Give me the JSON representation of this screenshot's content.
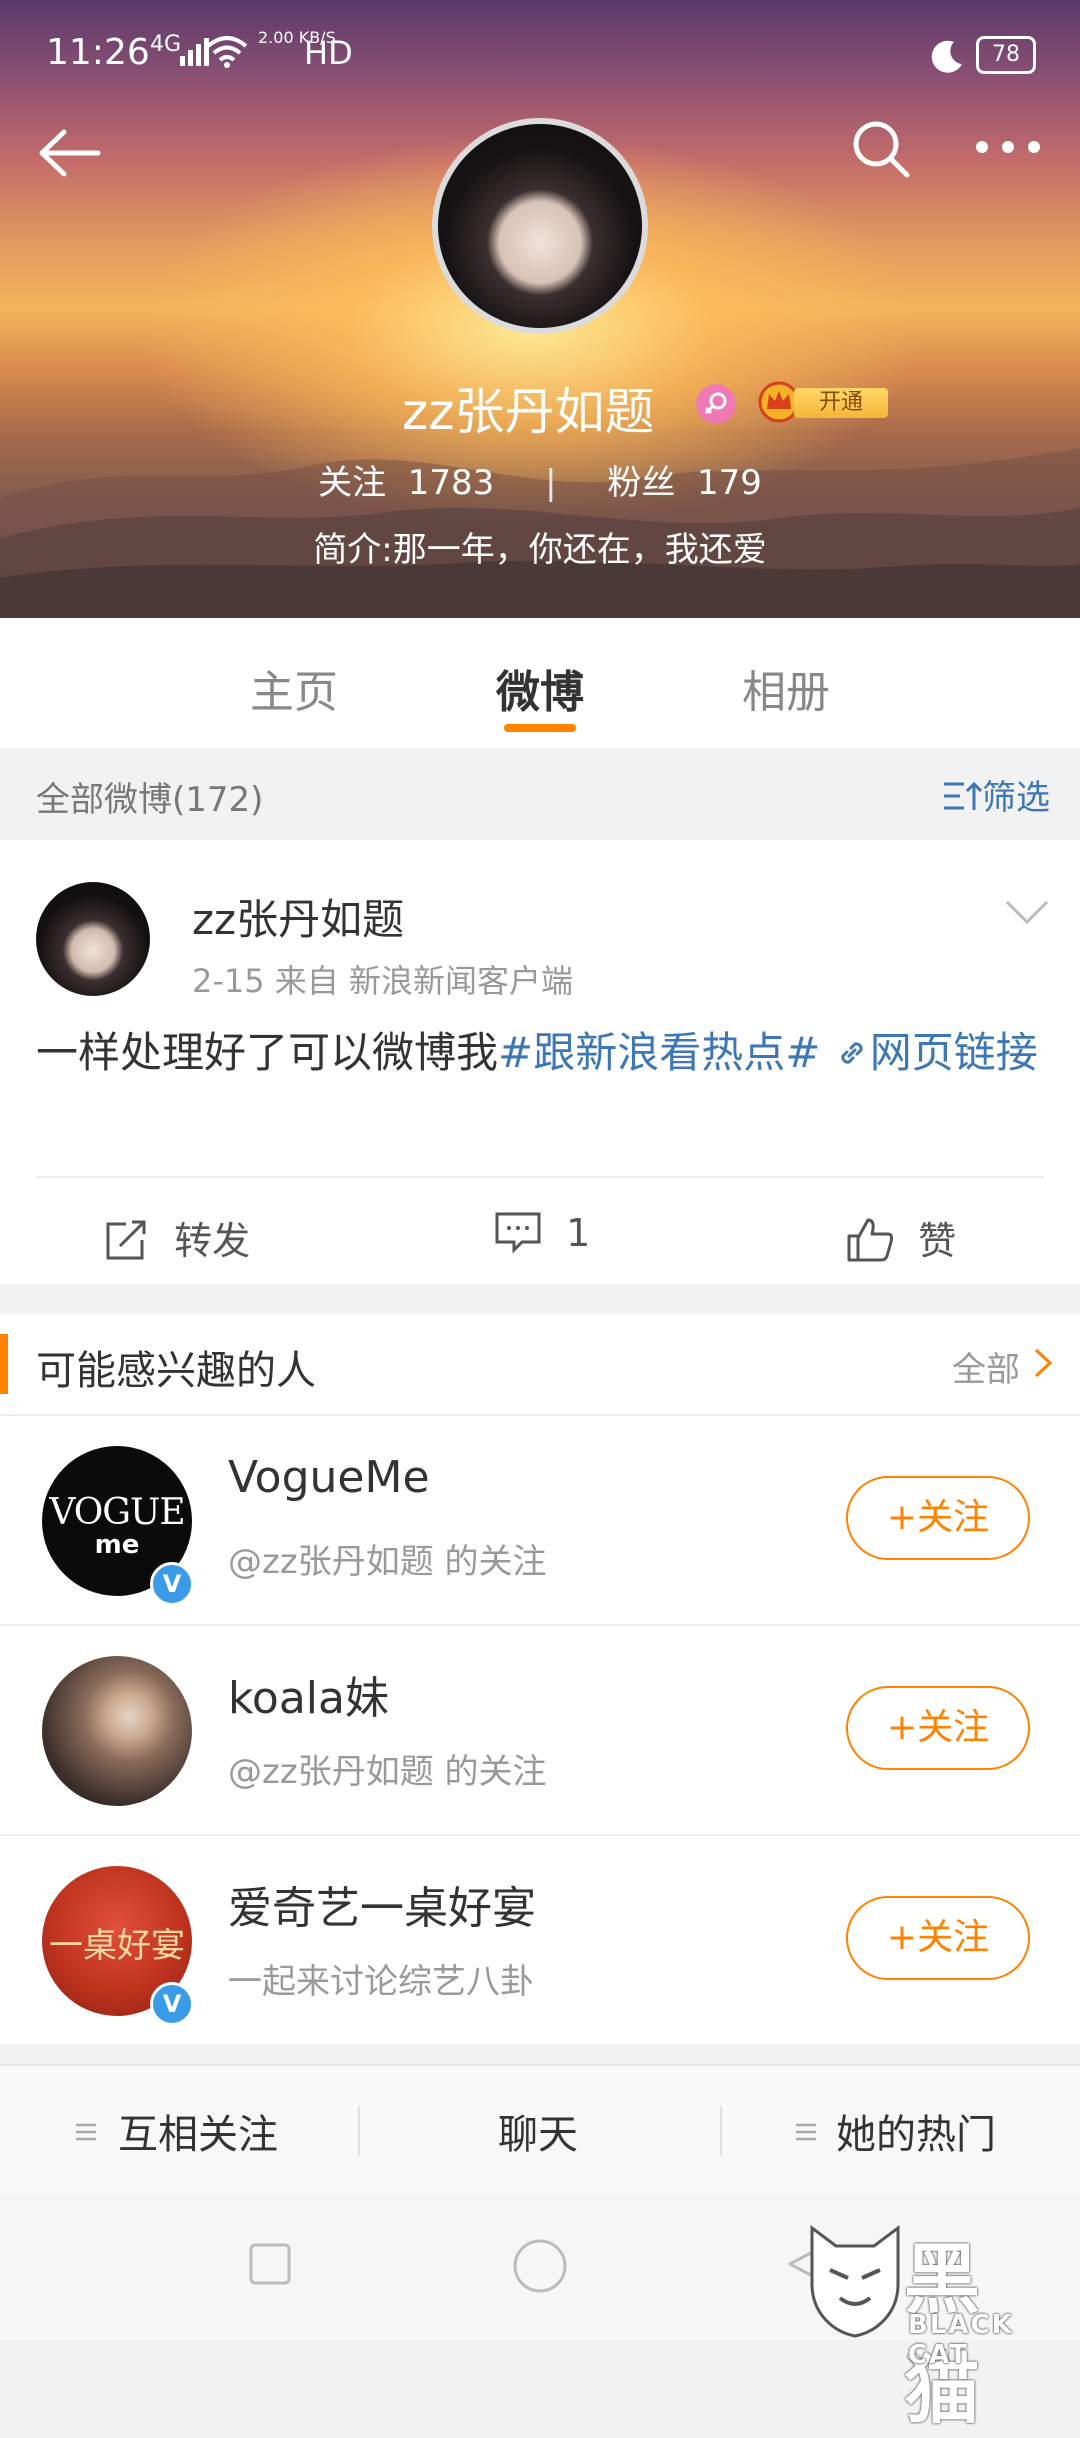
{
  "status_bar": {
    "time": "11:26",
    "network": "4G",
    "speed": "2.00 KB/S",
    "hd": "HD",
    "battery": "78"
  },
  "profile": {
    "name": "zz张丹如题",
    "vip_label": "开通",
    "following_label": "关注",
    "following_count": "1783",
    "separator": "|",
    "followers_label": "粉丝",
    "followers_count": "179",
    "intro": "简介:那一年，你还在，我还爱"
  },
  "tabs": [
    {
      "label": "主页"
    },
    {
      "label": "微博"
    },
    {
      "label": "相册"
    }
  ],
  "filter_bar": {
    "label": "全部微博(172)",
    "filter": "筛选"
  },
  "post": {
    "author": "zz张丹如题",
    "meta": "2-15  来自 新浪新闻客户端",
    "text_plain": "一样处理好了可以微博我",
    "hashtag": "#跟新浪看热点#",
    "link": "网页链接",
    "repost_label": "转发",
    "comment_count": "1",
    "like_label": "赞"
  },
  "recommend": {
    "title": "可能感兴趣的人",
    "all_label": "全部",
    "items": [
      {
        "name": "VogueMe",
        "sub": "@zz张丹如题 的关注",
        "follow": "+关注",
        "avatar_text": "VOGUE",
        "avatar_text2": "me"
      },
      {
        "name": "koala妹",
        "sub": "@zz张丹如题 的关注",
        "follow": "+关注"
      },
      {
        "name": "爱奇艺一桌好宴",
        "sub": "一起来讨论综艺八卦",
        "follow": "+关注",
        "avatar_text": "一桌好宴"
      }
    ]
  },
  "bottom_bar": {
    "mutual": "互相关注",
    "chat": "聊天",
    "hot": "她的热门"
  },
  "watermark": {
    "text_cn": "黑猫",
    "text_en": "BLACK CAT"
  },
  "colors": {
    "accent": "#ff8200",
    "link": "#3d77b5",
    "verified": "#3a9be8"
  }
}
